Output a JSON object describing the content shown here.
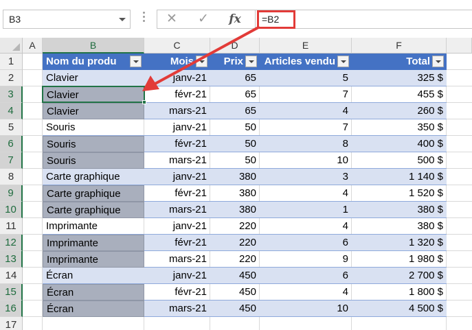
{
  "name_box": {
    "value": "B3"
  },
  "formula_bar": {
    "cancel_glyph": "✕",
    "enter_glyph": "✓",
    "fx_label": "fx",
    "formula": "=B2"
  },
  "colors": {
    "header_blue": "#4472c4",
    "band_blue": "#d9e1f2",
    "annotation_red": "#e23b38",
    "selection_green": "#217346",
    "merged_gray": "#a9afbd"
  },
  "columns": [
    "A",
    "B",
    "C",
    "D",
    "E",
    "F"
  ],
  "rows": [
    "1",
    "2",
    "3",
    "4",
    "5",
    "6",
    "7",
    "8",
    "9",
    "10",
    "11",
    "12",
    "13",
    "14",
    "15",
    "16",
    "17"
  ],
  "selected_column": "B",
  "selected_rows": [
    "3",
    "4",
    "6",
    "7",
    "9",
    "10",
    "12",
    "13",
    "15",
    "16"
  ],
  "table": {
    "headers": [
      "Nom du produ",
      "Mois",
      "Prix",
      "Articles vendu",
      "Total"
    ],
    "rows": [
      [
        "Clavier",
        "janv-21",
        "65",
        "5",
        "325 $"
      ],
      [
        "Clavier",
        "févr-21",
        "65",
        "7",
        "455 $"
      ],
      [
        "Clavier",
        "mars-21",
        "65",
        "4",
        "260 $"
      ],
      [
        "Souris",
        "janv-21",
        "50",
        "7",
        "350 $"
      ],
      [
        "Souris",
        "févr-21",
        "50",
        "8",
        "400 $"
      ],
      [
        "Souris",
        "mars-21",
        "50",
        "10",
        "500 $"
      ],
      [
        "Carte graphique",
        "janv-21",
        "380",
        "3",
        "1 140 $"
      ],
      [
        "Carte graphique",
        "févr-21",
        "380",
        "4",
        "1 520 $"
      ],
      [
        "Carte graphique",
        "mars-21",
        "380",
        "1",
        "380 $"
      ],
      [
        "Imprimante",
        "janv-21",
        "220",
        "4",
        "380 $"
      ],
      [
        "Imprimante",
        "févr-21",
        "220",
        "6",
        "1 320 $"
      ],
      [
        "Imprimante",
        "mars-21",
        "220",
        "9",
        "1 980 $"
      ],
      [
        "Écran",
        "janv-21",
        "450",
        "6",
        "2 700 $"
      ],
      [
        "Écran",
        "févr-21",
        "450",
        "4",
        "1 800 $"
      ],
      [
        "Écran",
        "mars-21",
        "450",
        "10",
        "4 500 $"
      ]
    ]
  }
}
